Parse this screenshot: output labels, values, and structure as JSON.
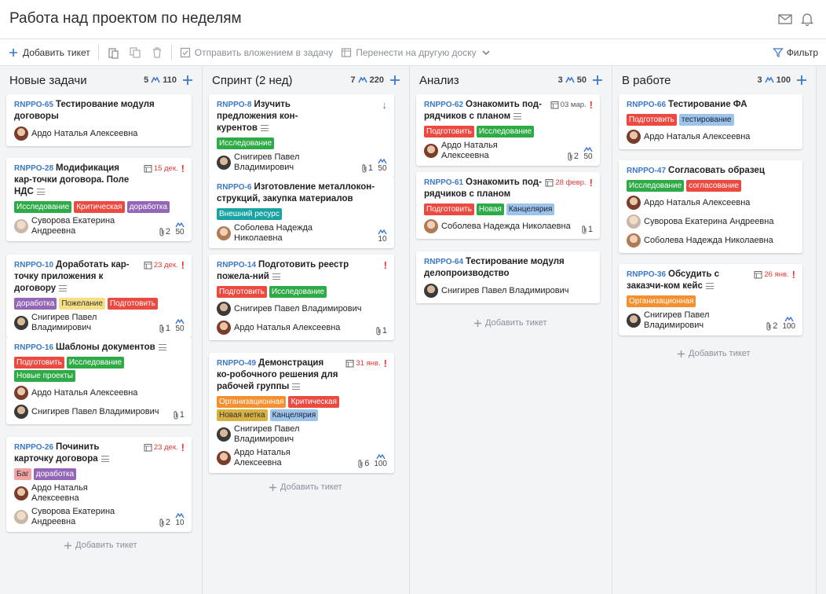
{
  "header": {
    "title": "Работа над проектом по неделям"
  },
  "toolbar": {
    "add_ticket": "Добавить тикет",
    "send_attachment": "Отправить вложением в задачу",
    "move_board": "Перенести на другую доску",
    "filter": "Фильтр"
  },
  "columns": [
    {
      "title": "Новые задачи",
      "count": "5",
      "points": "110",
      "add_ticket": "Добавить тикет",
      "cards": [
        {
          "id": "RNPPO-65",
          "title": "Тестирование модуля договоры",
          "people": [
            "Ардо Наталья Алексеевна"
          ]
        },
        {
          "id": "RNPPO-28",
          "title": "Модификация кар-точки договора. Поле НДС",
          "due": "15 дек.",
          "tags": [
            "Исследование",
            "Критическая",
            "доработка"
          ],
          "people": [
            "Суворова Екатерина Андреевна"
          ],
          "attachments": "2",
          "points": "50"
        },
        {
          "id": "RNPPO-10",
          "title": "Доработать кар-точку приложения к договору",
          "due": "23 дек.",
          "tags": [
            "доработка",
            "Пожелание",
            "Подготовить"
          ],
          "people": [
            "Снигирев Павел Владимирович"
          ],
          "attachments": "1",
          "points": "50"
        },
        {
          "id": "RNPPO-16",
          "title": "Шаблоны документов",
          "tags": [
            "Подготовить",
            "Исследование",
            "Новые проекты"
          ],
          "people": [
            "Ардо Наталья Алексеевна",
            "Снигирев Павел Владимирович"
          ],
          "attachments": "1"
        },
        {
          "id": "RNPPO-26",
          "title": "Починить карточку договора",
          "due": "23 дек.",
          "tags": [
            "Баг",
            "доработка"
          ],
          "people": [
            "Ардо Наталья Алексеевна",
            "Суворова Екатерина Андреевна"
          ],
          "attachments": "2",
          "points": "10"
        }
      ]
    },
    {
      "title": "Спринт (2 нед)",
      "count": "7",
      "points": "220",
      "add_ticket": "Добавить тикет",
      "cards": [
        {
          "id": "RNPPO-8",
          "title": "Изучить предложения кон-курентов",
          "tags": [
            "Исследование"
          ],
          "people": [
            "Снигирев Павел Владимирович"
          ],
          "attachments": "1",
          "points": "50"
        },
        {
          "id": "RNPPO-6",
          "title": "Изготовление металлокон-струкций, закупка материалов",
          "tags": [
            "Внешний ресурс"
          ],
          "people": [
            "Соболева Надежда Николаевна"
          ],
          "points": "10"
        },
        {
          "id": "RNPPO-14",
          "title": "Подготовить реестр пожела-ний",
          "tags": [
            "Подготовить",
            "Исследование"
          ],
          "people": [
            "Снигирев Павел Владимирович",
            "Ардо Наталья Алексеевна"
          ],
          "attachments": "1"
        },
        {
          "id": "RNPPO-49",
          "title": "Демонстрация ко-робочного решения для рабочей группы",
          "due": "31 янв.",
          "tags": [
            "Организационная",
            "Критическая",
            "Новая метка",
            "Канцелярия"
          ],
          "people": [
            "Снигирев Павел Владимирович",
            "Ардо Наталья Алексеевна"
          ],
          "attachments": "6",
          "points": "100"
        }
      ]
    },
    {
      "title": "Анализ",
      "count": "3",
      "points": "50",
      "add_ticket": "Добавить тикет",
      "cards": [
        {
          "id": "RNPPO-62",
          "title": "Ознакомить под-рядчиков с планом",
          "due": "03 мар.",
          "tags": [
            "Подготовить",
            "Исследование"
          ],
          "people": [
            "Ардо Наталья Алексеевна"
          ],
          "attachments": "2",
          "points": "50"
        },
        {
          "id": "RNPPO-61",
          "title": "Ознакомить под-рядчиков с планом",
          "due": "28 февр.",
          "tags": [
            "Подготовить",
            "Новая",
            "Канцелярия"
          ],
          "people": [
            "Соболева Надежда Николаевна"
          ],
          "attachments": "1"
        },
        {
          "id": "RNPPO-64",
          "title": "Тестирование модуля делопроизводство",
          "people": [
            "Снигирев Павел Владимирович"
          ]
        }
      ]
    },
    {
      "title": "В работе",
      "count": "3",
      "points": "100",
      "add_ticket": "Добавить тикет",
      "cards": [
        {
          "id": "RNPPO-66",
          "title": "Тестирование ФА",
          "tags": [
            "Подготовить",
            "тестирование"
          ],
          "people": [
            "Ардо Наталья Алексеевна"
          ]
        },
        {
          "id": "RNPPO-47",
          "title": "Согласовать образец",
          "tags": [
            "Исследование",
            "согласование"
          ],
          "people": [
            "Ардо Наталья Алексеевна",
            "Суворова Екатерина Андреевна",
            "Соболева Надежда Николаевна"
          ]
        },
        {
          "id": "RNPPO-36",
          "title": "Обсудить с заказчи-ком кейс",
          "due": "26 янв.",
          "tags": [
            "Организационная"
          ],
          "people": [
            "Снигирев Павел Владимирович"
          ],
          "attachments": "2",
          "points": "100"
        }
      ]
    }
  ]
}
